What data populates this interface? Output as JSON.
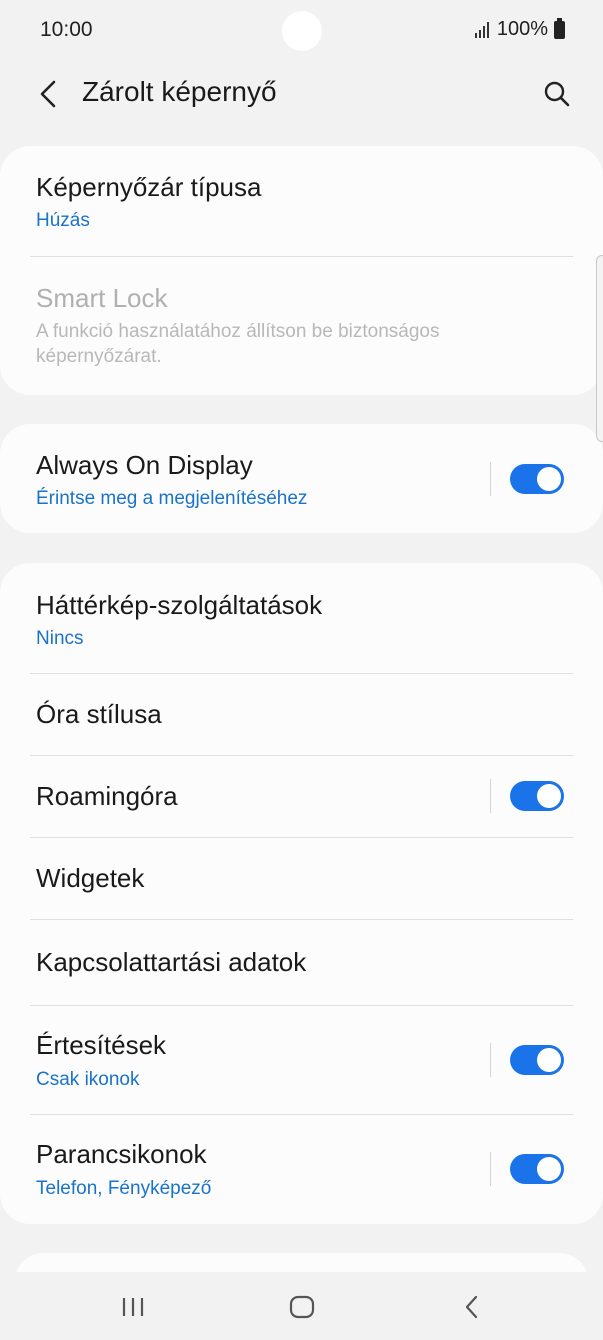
{
  "status": {
    "time": "10:00",
    "battery": "100%"
  },
  "header": {
    "title": "Zárolt képernyő"
  },
  "sections": {
    "lock": {
      "screen_lock_type": {
        "label": "Képernyőzár típusa",
        "value": "Húzás"
      },
      "smart_lock": {
        "label": "Smart Lock",
        "description": "A funkció használatához állítson be biztonságos képernyőzárat."
      }
    },
    "aod": {
      "label": "Always On Display",
      "value": "Érintse meg a megjelenítéséhez",
      "enabled": true
    },
    "other": {
      "wallpaper_services": {
        "label": "Háttérkép-szolgáltatások",
        "value": "Nincs"
      },
      "clock_style": {
        "label": "Óra stílusa"
      },
      "roaming_clock": {
        "label": "Roamingóra",
        "enabled": true
      },
      "widgets": {
        "label": "Widgetek"
      },
      "contact_info": {
        "label": "Kapcsolattartási adatok"
      },
      "notifications": {
        "label": "Értesítések",
        "value": "Csak ikonok",
        "enabled": true
      },
      "shortcuts": {
        "label": "Parancsikonok",
        "value": "Telefon, Fényképező",
        "enabled": true
      }
    }
  },
  "navbar": {
    "recent": "recent-apps-icon",
    "home": "home-icon",
    "back": "back-icon"
  },
  "colors": {
    "accent": "#1a73e8",
    "link": "#1a73c9",
    "background": "#f2f2f2",
    "card": "#fcfcfc"
  }
}
